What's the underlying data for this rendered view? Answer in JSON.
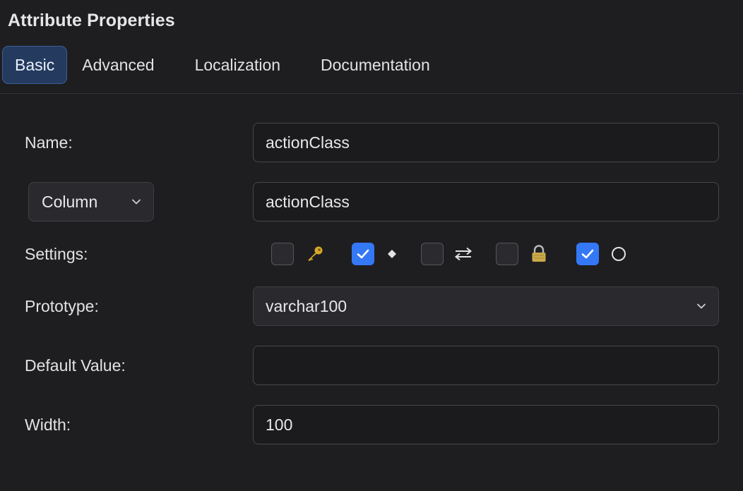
{
  "panel": {
    "title": "Attribute Properties"
  },
  "tabs": [
    {
      "label": "Basic",
      "active": true
    },
    {
      "label": "Advanced",
      "active": false
    },
    {
      "label": "Localization",
      "active": false
    },
    {
      "label": "Documentation",
      "active": false
    }
  ],
  "form": {
    "name_label": "Name:",
    "name_value": "actionClass",
    "column_select_value": "Column",
    "column_value": "actionClass",
    "settings_label": "Settings:",
    "settings": [
      {
        "icon": "key-icon",
        "glyph": "🔑",
        "checked": false
      },
      {
        "icon": "diamond-icon",
        "glyph": "◆",
        "checked": true
      },
      {
        "icon": "swap-arrows-icon",
        "glyph": "⇄",
        "checked": false
      },
      {
        "icon": "lock-icon",
        "glyph": "🔒",
        "checked": false
      },
      {
        "icon": "circle-icon",
        "glyph": "○",
        "checked": true
      }
    ],
    "prototype_label": "Prototype:",
    "prototype_value": "varchar100",
    "default_value_label": "Default Value:",
    "default_value": "",
    "width_label": "Width:",
    "width_value": "100"
  },
  "colors": {
    "background": "#1e1e21",
    "active_tab": "#243a5e",
    "checkbox_checked": "#3478f6",
    "key_icon": "#d9a82a",
    "lock_icon": "#c9a94a"
  }
}
